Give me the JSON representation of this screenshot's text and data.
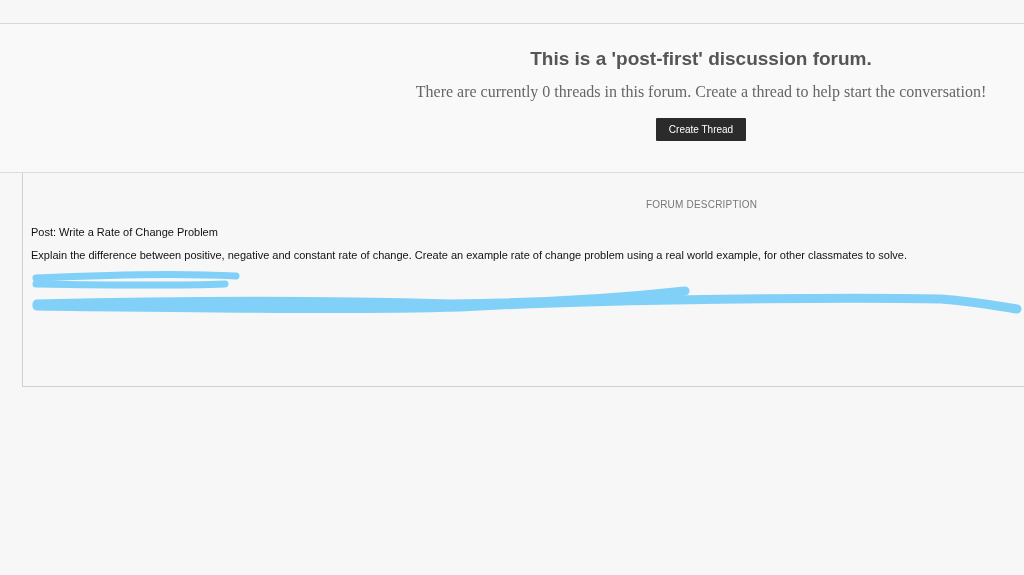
{
  "header": {
    "title": "This is a 'post-first' discussion forum.",
    "message": "There are currently 0 threads in this forum. Create a thread to help start the conversation!",
    "button": "Create Thread"
  },
  "description": {
    "heading": "FORUM DESCRIPTION",
    "paragraphs": [
      "Post: Write a Rate of Change Problem",
      "Explain the difference between positive, negative and constant rate of change.  Create an example rate of change problem using a real world example, for other classmates to solve."
    ]
  }
}
